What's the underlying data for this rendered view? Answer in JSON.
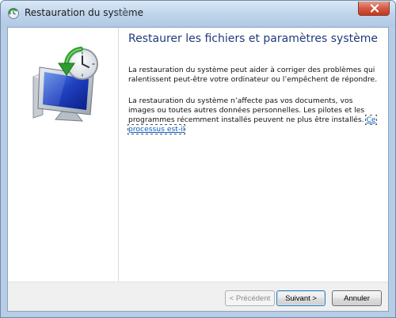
{
  "window": {
    "title": "Restauration du système"
  },
  "icons": {
    "title_icon": "system-restore-icon",
    "hero_icon": "system-restore-monitor-clock-icon",
    "close_icon": "close-icon"
  },
  "colors": {
    "heading": "#1f3c7a",
    "link": "#0b5fc0",
    "close_button": "#c1391f"
  },
  "main": {
    "heading": "Restaurer les fichiers et paramètres système",
    "paragraph1": "La restauration du système peut aider à corriger des problèmes qui ralentissent peut-être votre ordinateur ou l’empêchent de répondre.",
    "paragraph2_text": "La restauration du système n’affecte pas vos documents, vos images ou toutes autres données personnelles. Les pilotes et les programmes récemment installés peuvent ne plus être installés.",
    "paragraph2_link": "Ce processus est-il"
  },
  "footer": {
    "prev_label": "< Précédent",
    "next_label": "Suivant >",
    "cancel_label": "Annuler"
  }
}
